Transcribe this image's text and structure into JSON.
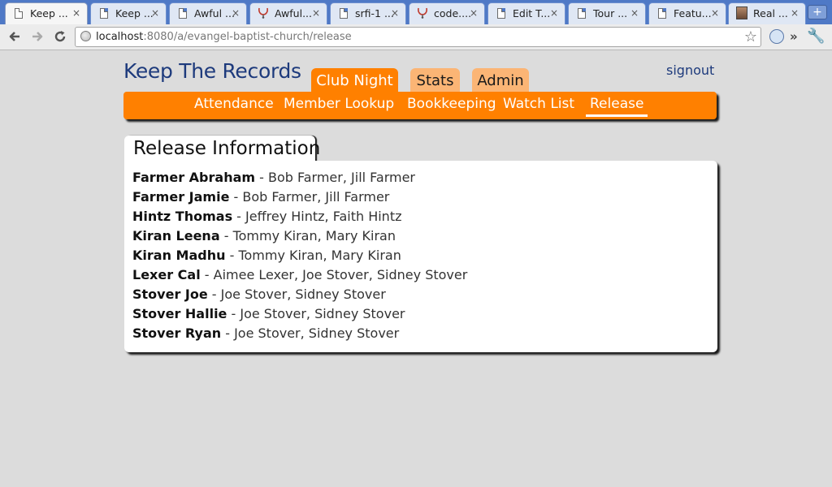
{
  "browser": {
    "tabs": [
      {
        "label": "Keep ...",
        "icon": "page-icon",
        "active": true
      },
      {
        "label": "Keep ...",
        "icon": "page-icon",
        "active": false
      },
      {
        "label": "Awful ...",
        "icon": "page-icon",
        "active": false
      },
      {
        "label": "Awful...",
        "icon": "stethoscope-icon",
        "active": false
      },
      {
        "label": "srfi-1 ...",
        "icon": "page-icon",
        "active": false
      },
      {
        "label": "code....",
        "icon": "stethoscope-icon",
        "active": false
      },
      {
        "label": "Edit T...",
        "icon": "page-icon",
        "active": false
      },
      {
        "label": "Tour ...",
        "icon": "page-icon",
        "active": false
      },
      {
        "label": "Featu...",
        "icon": "page-icon",
        "active": false
      },
      {
        "label": "Real ...",
        "icon": "avatar-icon",
        "active": false
      }
    ],
    "close_glyph": "×",
    "new_tab_glyph": "+",
    "url_host": "localhost",
    "url_rest": ":8080/a/evangel-baptist-church/release"
  },
  "app": {
    "title": "Keep The Records",
    "signout": "signout",
    "main_tabs": [
      {
        "label": "Club Night",
        "active": true
      },
      {
        "label": "Stats",
        "active": false
      },
      {
        "label": "Admin",
        "active": false
      }
    ],
    "sub_nav": [
      {
        "label": "Attendance",
        "active": false
      },
      {
        "label": "Member Lookup",
        "active": false
      },
      {
        "label": "Bookkeeping",
        "active": false
      },
      {
        "label": "Watch List",
        "active": false
      },
      {
        "label": "Release",
        "active": true
      }
    ],
    "colors": {
      "accent": "#ff8000",
      "accent_light": "#fbb575",
      "title": "#1d3a7c"
    }
  },
  "release": {
    "section_title": "Release Information",
    "separator": " - ",
    "rows": [
      {
        "child": "Farmer Abraham",
        "guardians": "Bob Farmer, Jill Farmer"
      },
      {
        "child": "Farmer Jamie",
        "guardians": "Bob Farmer, Jill Farmer"
      },
      {
        "child": "Hintz Thomas",
        "guardians": "Jeffrey Hintz, Faith Hintz"
      },
      {
        "child": "Kiran Leena",
        "guardians": "Tommy Kiran, Mary Kiran"
      },
      {
        "child": "Kiran Madhu",
        "guardians": "Tommy Kiran, Mary Kiran"
      },
      {
        "child": "Lexer Cal",
        "guardians": "Aimee Lexer, Joe Stover, Sidney Stover"
      },
      {
        "child": "Stover Joe",
        "guardians": "Joe Stover, Sidney Stover"
      },
      {
        "child": "Stover Hallie",
        "guardians": "Joe Stover, Sidney Stover"
      },
      {
        "child": "Stover Ryan",
        "guardians": "Joe Stover, Sidney Stover"
      }
    ]
  }
}
